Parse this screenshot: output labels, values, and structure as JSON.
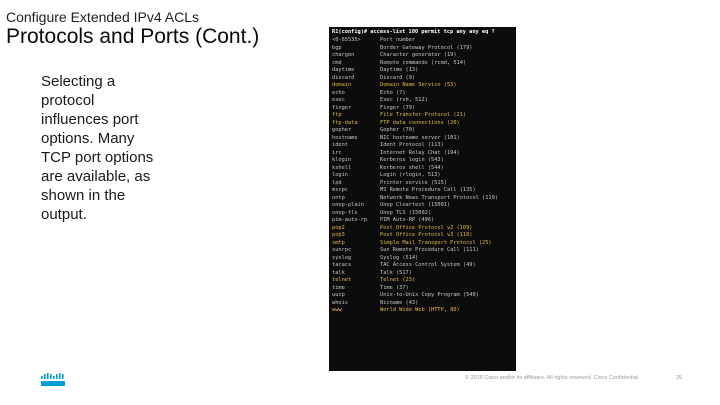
{
  "header": {
    "kicker": "Configure Extended IPv4 ACLs",
    "title": "Protocols and Ports (Cont.)"
  },
  "body": {
    "text": "Selecting a protocol influences port options. Many TCP port options are available, as shown in the output."
  },
  "terminal": {
    "command": "R1(config)# access-list 100 permit tcp any any eq ?",
    "highlight_color": "#e5b94a",
    "rows": [
      {
        "kw": "<0-65535>",
        "desc": "Port number",
        "hl": false
      },
      {
        "kw": "bgp",
        "desc": "Border Gateway Protocol (179)",
        "hl": false
      },
      {
        "kw": "chargen",
        "desc": "Character generator (19)",
        "hl": false
      },
      {
        "kw": "cmd",
        "desc": "Remote commands (rcmd, 514)",
        "hl": false
      },
      {
        "kw": "daytime",
        "desc": "Daytime (13)",
        "hl": false
      },
      {
        "kw": "discard",
        "desc": "Discard (9)",
        "hl": false
      },
      {
        "kw": "domain",
        "desc": "Domain Name Service (53)",
        "hl": true
      },
      {
        "kw": "echo",
        "desc": "Echo (7)",
        "hl": false
      },
      {
        "kw": "exec",
        "desc": "Exec (rsh, 512)",
        "hl": false
      },
      {
        "kw": "finger",
        "desc": "Finger (79)",
        "hl": false
      },
      {
        "kw": "ftp",
        "desc": "File Transfer Protocol (21)",
        "hl": true
      },
      {
        "kw": "ftp-data",
        "desc": "FTP data connections (20)",
        "hl": true
      },
      {
        "kw": "gopher",
        "desc": "Gopher (70)",
        "hl": false
      },
      {
        "kw": "hostname",
        "desc": "NIC hostname server (101)",
        "hl": false
      },
      {
        "kw": "ident",
        "desc": "Ident Protocol (113)",
        "hl": false
      },
      {
        "kw": "irc",
        "desc": "Internet Relay Chat (194)",
        "hl": false
      },
      {
        "kw": "klogin",
        "desc": "Kerberos login (543)",
        "hl": false
      },
      {
        "kw": "kshell",
        "desc": "Kerberos shell (544)",
        "hl": false
      },
      {
        "kw": "login",
        "desc": "Login (rlogin, 513)",
        "hl": false
      },
      {
        "kw": "lpd",
        "desc": "Printer service (515)",
        "hl": false
      },
      {
        "kw": "msrpc",
        "desc": "MS Remote Procedure Call (135)",
        "hl": false
      },
      {
        "kw": "nntp",
        "desc": "Network News Transport Protocol (119)",
        "hl": false
      },
      {
        "kw": "onep-plain",
        "desc": "Onep Cleartext (15001)",
        "hl": false
      },
      {
        "kw": "onep-tls",
        "desc": "Onep TLS (15002)",
        "hl": false
      },
      {
        "kw": "pim-auto-rp",
        "desc": "PIM Auto-RP (496)",
        "hl": false
      },
      {
        "kw": "pop2",
        "desc": "Post Office Protocol v2 (109)",
        "hl": true
      },
      {
        "kw": "pop3",
        "desc": "Post Office Protocol v3 (110)",
        "hl": true
      },
      {
        "kw": "smtp",
        "desc": "Simple Mail Transport Protocol (25)",
        "hl": true
      },
      {
        "kw": "sunrpc",
        "desc": "Sun Remote Procedure Call (111)",
        "hl": false
      },
      {
        "kw": "syslog",
        "desc": "Syslog (514)",
        "hl": false
      },
      {
        "kw": "tacacs",
        "desc": "TAC Access Control System (49)",
        "hl": false
      },
      {
        "kw": "talk",
        "desc": "Talk (517)",
        "hl": false
      },
      {
        "kw": "telnet",
        "desc": "Telnet (23)",
        "hl": true
      },
      {
        "kw": "time",
        "desc": "Time (37)",
        "hl": false
      },
      {
        "kw": "uucp",
        "desc": "Unix-to-Unix Copy Program (540)",
        "hl": false
      },
      {
        "kw": "whois",
        "desc": "Nicname (43)",
        "hl": false
      },
      {
        "kw": "www",
        "desc": "World Wide Web (HTTP, 80)",
        "hl": true
      }
    ]
  },
  "footer": {
    "copyright": "© 2016 Cisco and/or its affiliates. All rights reserved. Cisco Confidential",
    "page_number": "25",
    "logo_icon": "cisco-logo-icon",
    "logo_color": "#049fd9"
  }
}
